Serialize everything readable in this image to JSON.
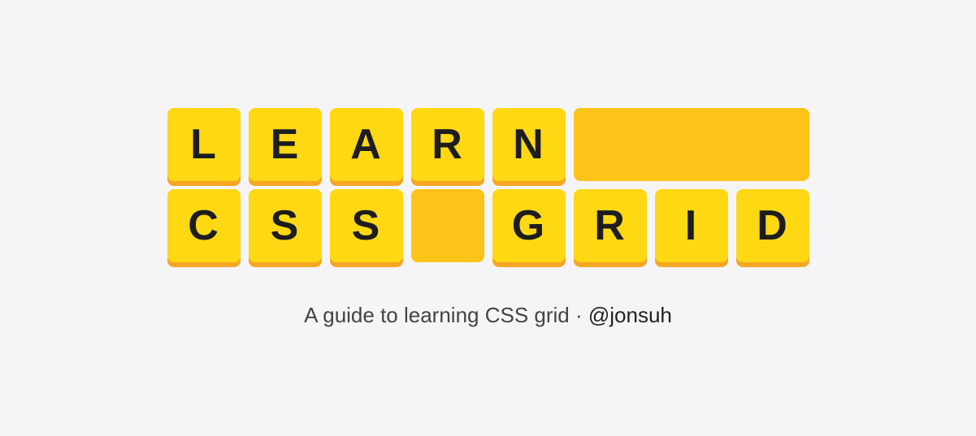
{
  "title_grid": {
    "row1": [
      "L",
      "E",
      "A",
      "R",
      "N"
    ],
    "row2": [
      "C",
      "S",
      "S",
      "",
      "G",
      "R",
      "I",
      "D"
    ]
  },
  "subtitle": {
    "text": "A guide to learning CSS grid",
    "separator": " · ",
    "author": "@jonsuh"
  },
  "colors": {
    "tile_bg": "#ffd814",
    "tile_shadow": "#f5a623",
    "empty_bg": "#fcc419",
    "page_bg": "#f5f5f7",
    "text": "#1d1d1f"
  }
}
